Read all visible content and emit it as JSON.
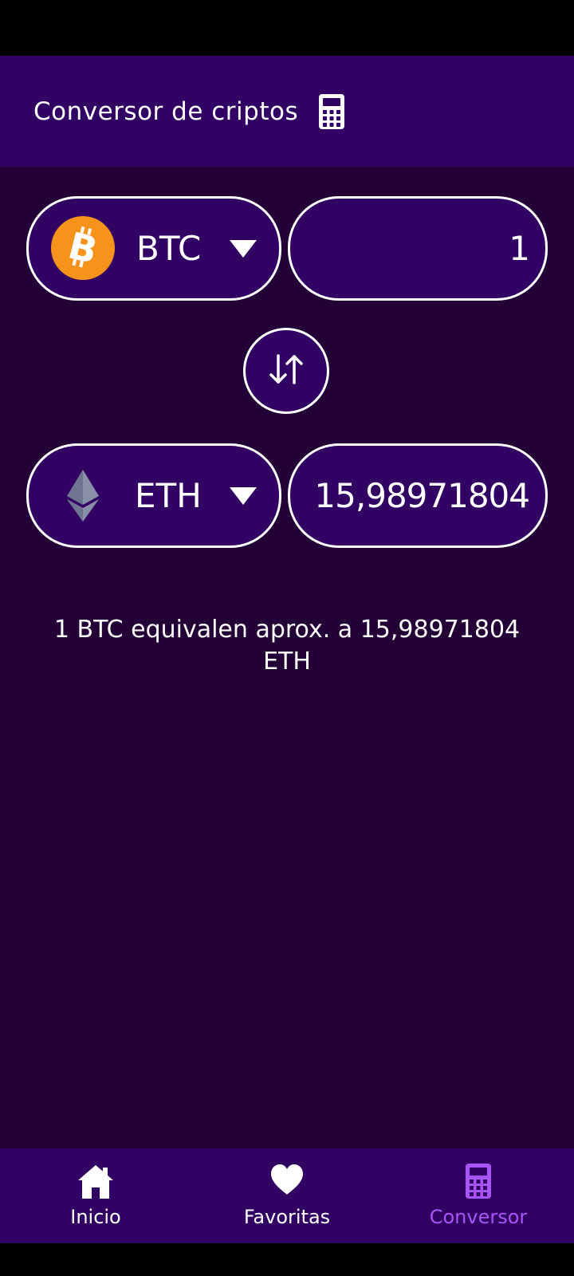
{
  "header": {
    "title": "Conversor de criptos",
    "icon": "calculator-icon"
  },
  "converter": {
    "from": {
      "code": "BTC",
      "icon": "bitcoin-icon",
      "amount": "1",
      "icon_color": "#f7931a"
    },
    "to": {
      "code": "ETH",
      "icon": "ethereum-icon",
      "amount": "15,98971804"
    },
    "swap_icon": "swap-vertical-icon",
    "result_text": "1 BTC equivalen aprox. a 15,98971804 ETH"
  },
  "nav": {
    "items": [
      {
        "label": "Inicio",
        "icon": "home-icon",
        "active": false
      },
      {
        "label": "Favoritas",
        "icon": "heart-icon",
        "active": false
      },
      {
        "label": "Conversor",
        "icon": "calculator-icon",
        "active": true
      }
    ],
    "active_color": "#a855f7"
  },
  "colors": {
    "app_bar": "#310164",
    "background": "#230036",
    "accent": "#a855f7"
  }
}
